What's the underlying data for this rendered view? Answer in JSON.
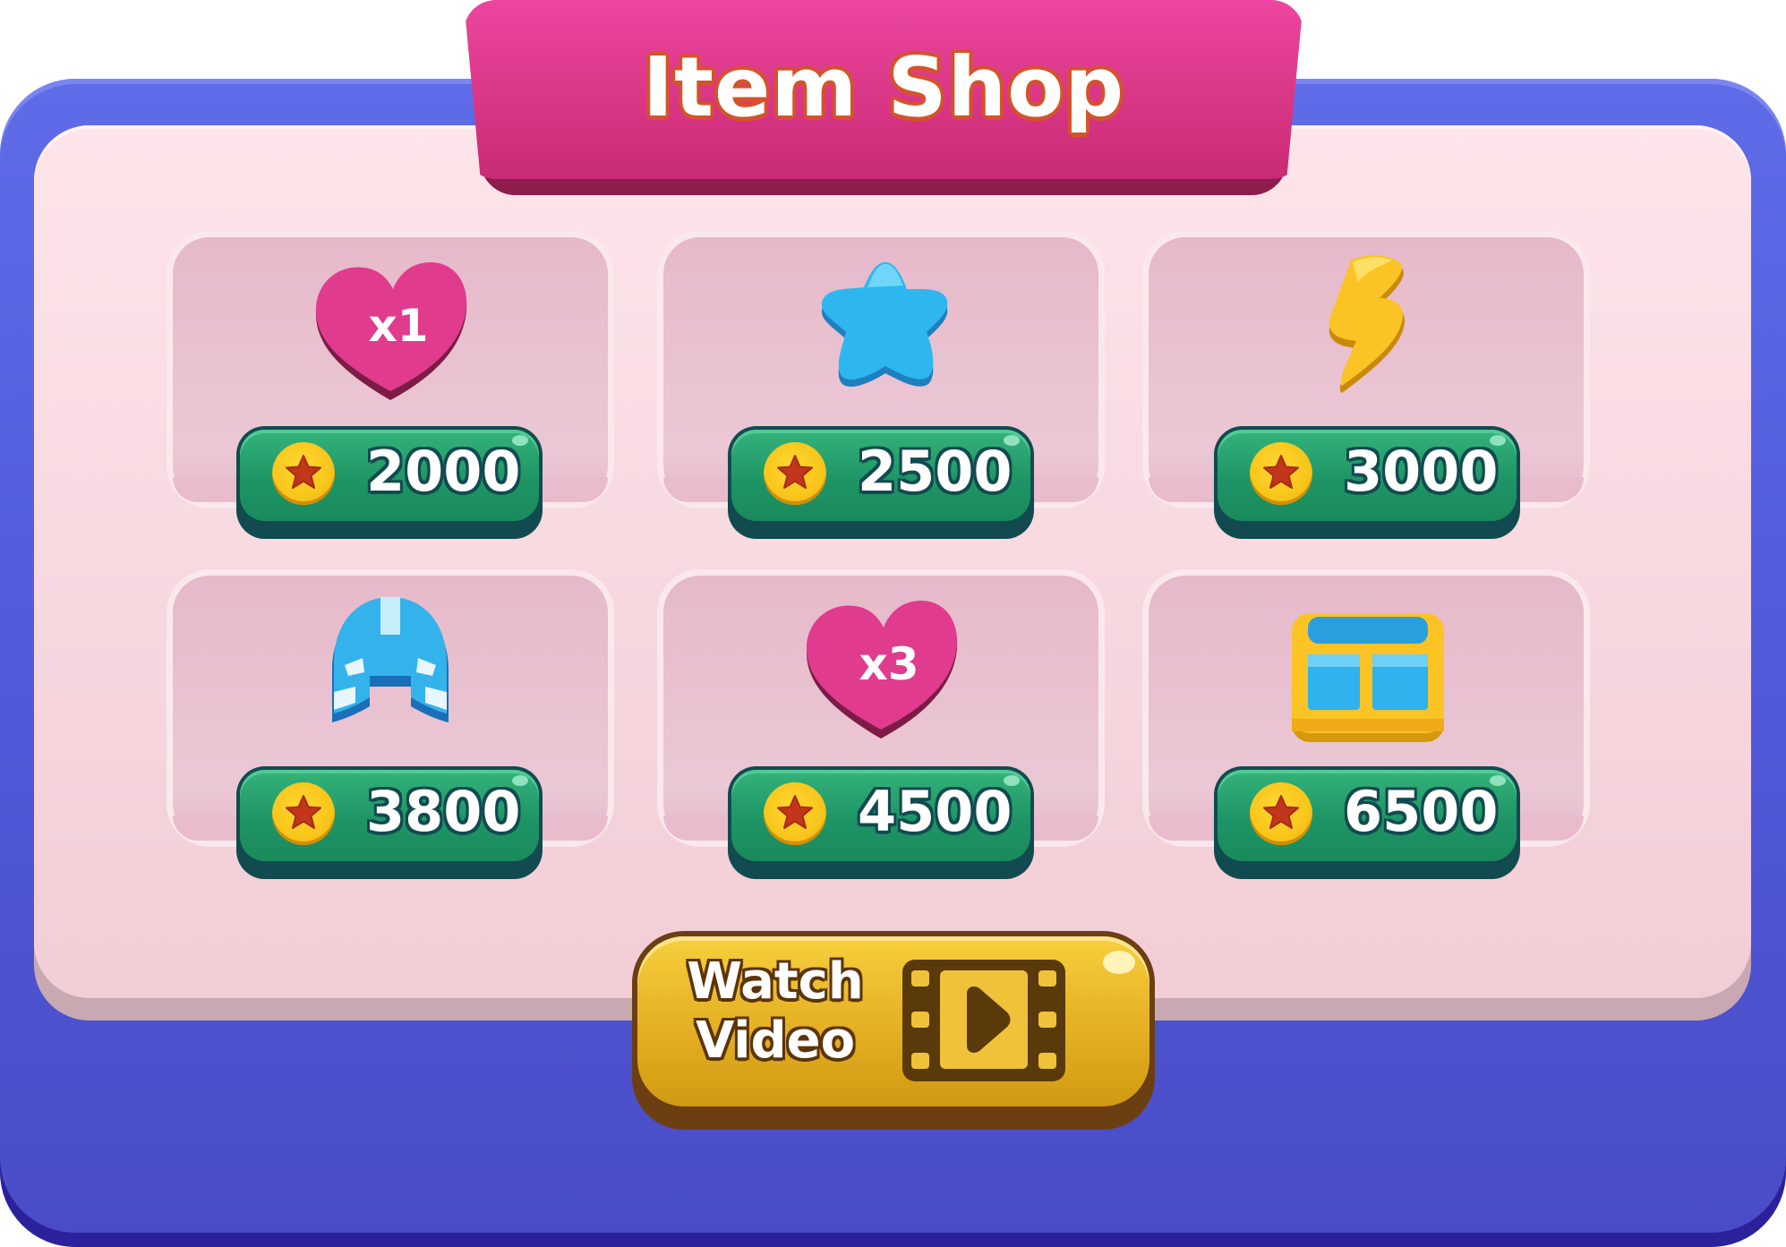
{
  "shop": {
    "title": "Item Shop",
    "items": [
      {
        "icon": "heart-icon",
        "badge": "x1",
        "price": "2000"
      },
      {
        "icon": "star-icon",
        "price": "2500"
      },
      {
        "icon": "lightning-bolt-icon",
        "price": "3000"
      },
      {
        "icon": "helmet-icon",
        "price": "3800"
      },
      {
        "icon": "heart-icon",
        "badge": "x3",
        "price": "4500"
      },
      {
        "icon": "treasure-chest-icon",
        "price": "6500"
      }
    ],
    "currency_icon": "coin-star-icon",
    "watch_video": {
      "line1": "Watch",
      "line2": "Video",
      "icon": "film-play-icon"
    }
  },
  "colors": {
    "frame": "#5059d8",
    "panel": "#f5d3dc",
    "title_tab": "#d83584",
    "buy_button": "#1e9566",
    "coin": "#f8c51a",
    "watch_button": "#e6b226"
  }
}
